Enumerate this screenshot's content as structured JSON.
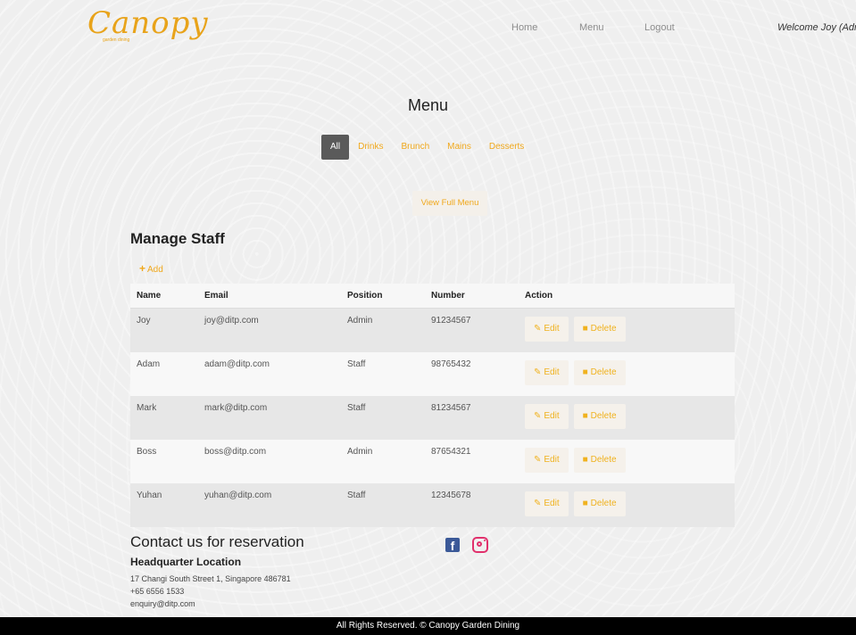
{
  "nav": {
    "logo": "Canopy",
    "logo_sub": "garden dining",
    "links": [
      "Home",
      "Menu",
      "Logout"
    ],
    "welcome": "Welcome Joy (Admin"
  },
  "menu": {
    "title": "Menu",
    "tabs": [
      "All",
      "Drinks",
      "Brunch",
      "Mains",
      "Desserts"
    ],
    "active_tab": "All",
    "view_full": "View Full Menu"
  },
  "staff": {
    "title": "Manage Staff",
    "add_label": "Add",
    "columns": [
      "Name",
      "Email",
      "Position",
      "Number",
      "Action"
    ],
    "edit_label": "Edit",
    "delete_label": "Delete",
    "rows": [
      {
        "name": "Joy",
        "email": "joy@ditp.com",
        "position": "Admin",
        "number": "91234567"
      },
      {
        "name": "Adam",
        "email": "adam@ditp.com",
        "position": "Staff",
        "number": "98765432"
      },
      {
        "name": "Mark",
        "email": "mark@ditp.com",
        "position": "Staff",
        "number": "81234567"
      },
      {
        "name": "Boss",
        "email": "boss@ditp.com",
        "position": "Admin",
        "number": "87654321"
      },
      {
        "name": "Yuhan",
        "email": "yuhan@ditp.com",
        "position": "Staff",
        "number": "12345678"
      }
    ]
  },
  "contact": {
    "title": "Contact us for reservation",
    "hq_title": "Headquarter Location",
    "address": "17 Changi South Street 1, Singapore 486781",
    "phone": "+65 6556 1533",
    "email": "enquiry@ditp.com"
  },
  "social": {
    "facebook_icon": "facebook-icon",
    "instagram_icon": "instagram-icon",
    "facebook_color": "#3b5998",
    "instagram_color": "#e1306c"
  },
  "footer": {
    "text": "All Rights Reserved. © Canopy Garden Dining"
  },
  "colors": {
    "accent": "#f0a81c",
    "active_tab_bg": "#5a5a5a"
  }
}
